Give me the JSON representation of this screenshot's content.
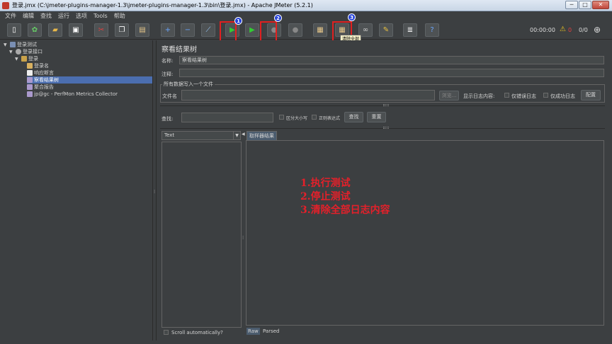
{
  "window": {
    "title": "登录.jmx (C:\\jmeter-plugins-manager-1.3\\jmeter-plugins-manager-1.3\\bin\\登录.jmx) - Apache JMeter (5.2.1)",
    "min": "─",
    "max": "□",
    "close": "✕"
  },
  "menu": [
    "文件",
    "编辑",
    "查找",
    "运行",
    "选项",
    "Tools",
    "帮助"
  ],
  "toolbar": {
    "badges": [
      "1",
      "2",
      "3"
    ],
    "tooltip": "清除全部",
    "elapsed": "00:00:00",
    "warnings": "0",
    "threads": "0/0"
  },
  "tree": [
    {
      "label": "登录测试",
      "icon": "test-plan-icon",
      "level": 0,
      "expanded": true
    },
    {
      "label": "登录接口",
      "icon": "thread-group-icon",
      "level": 1,
      "expanded": true
    },
    {
      "label": "登录",
      "icon": "sampler-icon",
      "level": 2,
      "expanded": true
    },
    {
      "label": "登录名",
      "icon": "extractor-icon",
      "level": 3
    },
    {
      "label": "响应断言",
      "icon": "assertion-icon",
      "level": 3
    },
    {
      "label": "察看结果树",
      "icon": "listener-icon",
      "level": 3,
      "selected": true
    },
    {
      "label": "聚合报告",
      "icon": "listener-icon",
      "level": 3
    },
    {
      "label": "jp@gc - PerfMon Metrics Collector",
      "icon": "listener-icon",
      "level": 3
    }
  ],
  "panel": {
    "title": "察看结果树",
    "name_label": "名称:",
    "name_value": "察看结果树",
    "comment_label": "注释:",
    "comment_value": "",
    "file_group_label": "所有数据写入一个文件",
    "filename_label": "文件名",
    "filename_value": "",
    "browse_label": "浏览...",
    "log_label": "显示日志内容:",
    "errors_only_label": "仅错误日志",
    "success_only_label": "仅成功日志",
    "configure_label": "配置",
    "search_label": "查找:",
    "search_value": "",
    "case_sensitive_label": "区分大小写",
    "regex_label": "正则表达式",
    "search_button": "查找",
    "reset_button": "重置",
    "renderer_value": "Text",
    "results_tab": "取样器结果",
    "scroll_auto_label": "Scroll automatically?",
    "raw_tab": "Raw",
    "parsed_tab": "Parsed"
  },
  "annotation": [
    "1.执行测试",
    "2.停止测试",
    "3.清除全部日志内容"
  ],
  "colors": {
    "annotation": "#e4202a",
    "highlight_box": "#e02020",
    "badge": "#2340d8",
    "selection": "#4b6eaf"
  }
}
